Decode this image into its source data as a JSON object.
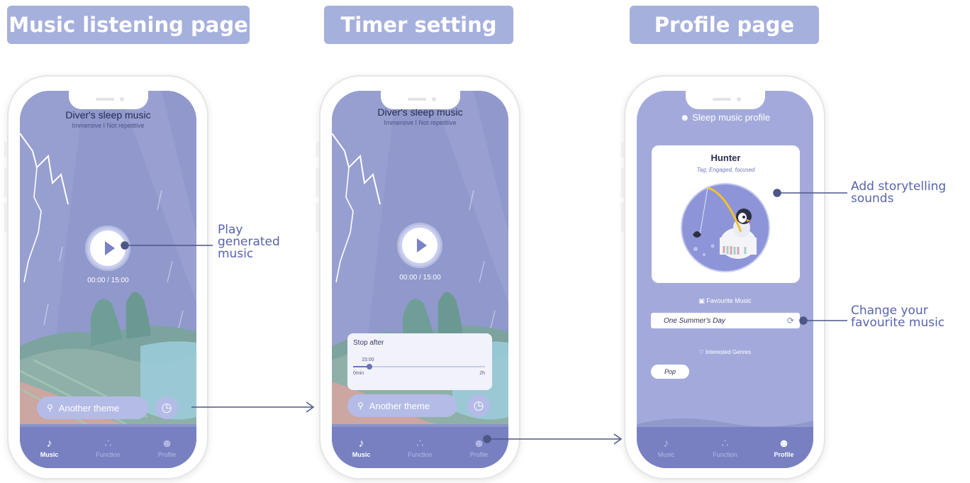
{
  "headers": {
    "music": "Music listening page",
    "timer": "Timer setting",
    "profile": "Profile page"
  },
  "player": {
    "title": "Diver's sleep music",
    "subtitle": "Immersive I Not repetitive",
    "time": "00:00 / 15:00",
    "theme_button": "Another theme"
  },
  "tabs": {
    "music": "Music",
    "function": "Function",
    "profile": "Profile"
  },
  "timer": {
    "label": "Stop after",
    "value": "15:00",
    "min": "0min",
    "max": "2h",
    "fraction": 0.125
  },
  "profile": {
    "title": "Sleep music profile",
    "name": "Hunter",
    "tag": "Tag: Engaged, focused",
    "favourite_label": "Favourite Music",
    "favourite_value": "One Summer's Day",
    "genres_label": "Interested Genres",
    "genre": "Pop"
  },
  "annotations": {
    "play": [
      "Play",
      "generated",
      "music"
    ],
    "storytelling": [
      "Add storytelling",
      "sounds"
    ],
    "favourite": [
      "Change your",
      "favourite music"
    ]
  },
  "colors": {
    "header_bg": "#a6b0dc",
    "accent": "#5863ad",
    "tabbar": "#7880c1",
    "screen_bg": "#8e97c9"
  }
}
